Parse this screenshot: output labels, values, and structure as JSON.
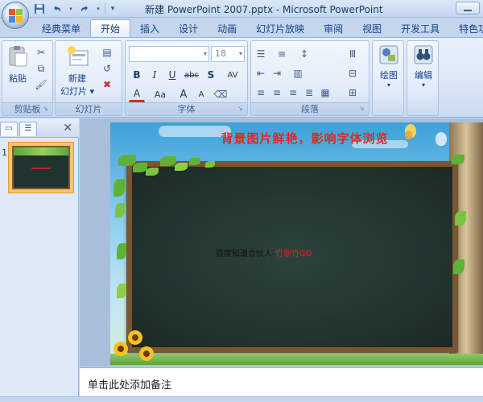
{
  "window": {
    "title": "新建 PowerPoint 2007.pptx - Microsoft PowerPoint"
  },
  "qat": {
    "save_icon": "save-icon",
    "undo_icon": "undo-icon",
    "redo_icon": "redo-icon"
  },
  "tabs": [
    {
      "label": "经典菜单"
    },
    {
      "label": "开始"
    },
    {
      "label": "插入"
    },
    {
      "label": "设计"
    },
    {
      "label": "动画"
    },
    {
      "label": "幻灯片放映"
    },
    {
      "label": "审阅"
    },
    {
      "label": "视图"
    },
    {
      "label": "开发工具"
    },
    {
      "label": "特色功"
    }
  ],
  "ribbon": {
    "clipboard": {
      "label": "剪贴板",
      "paste": "粘贴"
    },
    "slides": {
      "label": "幻灯片",
      "new_slide_line1": "新建",
      "new_slide_line2": "幻灯片 ▾"
    },
    "font": {
      "label": "字体",
      "font_size": "18",
      "bold": "B",
      "italic": "I",
      "underline": "U",
      "strike": "abc",
      "shadow": "S",
      "spacing": "AV",
      "font_color": "A",
      "change_case": "Aa",
      "grow": "A",
      "shrink": "A"
    },
    "paragraph": {
      "label": "段落"
    },
    "drawing": {
      "label": "绘图"
    },
    "editing": {
      "label": "编辑"
    }
  },
  "slide_panel": {
    "slide_number": "1"
  },
  "slide": {
    "title": "背景图片鲜艳，影响字体浏览",
    "body_black": "百度知道合伙人-",
    "body_red": "竹非竹GO"
  },
  "notes": {
    "placeholder": "单击此处添加备注"
  },
  "colors": {
    "ribbon_bg": "#dbe7f7",
    "accent": "#15428b",
    "title_red": "#e0281e",
    "board_green": "#1f302b",
    "board_frame": "#7a5631"
  }
}
